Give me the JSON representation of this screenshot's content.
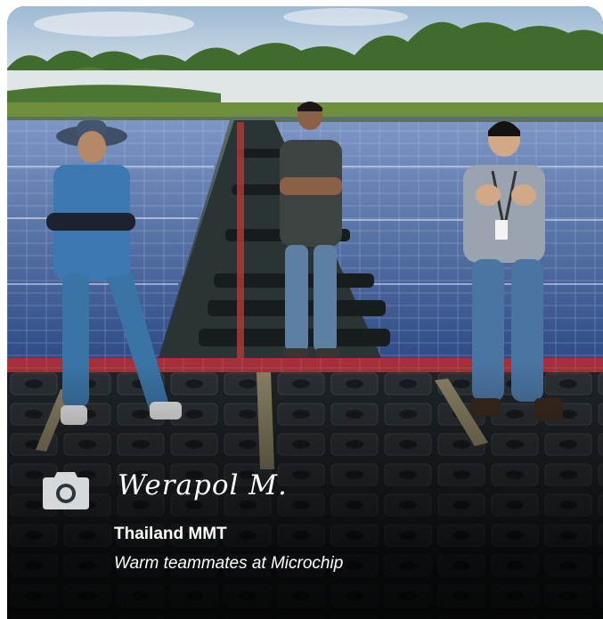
{
  "photo": {
    "description_icon": "camera-icon"
  },
  "author": "Werapol M.",
  "location": "Thailand MMT",
  "caption": "Warm teammates at Microchip",
  "colors": {
    "text": "#ffffff",
    "sky": "#a9c4dd",
    "panel": "#3b5f9e",
    "water": "#2c3a3a",
    "floats": "#1e2226"
  }
}
